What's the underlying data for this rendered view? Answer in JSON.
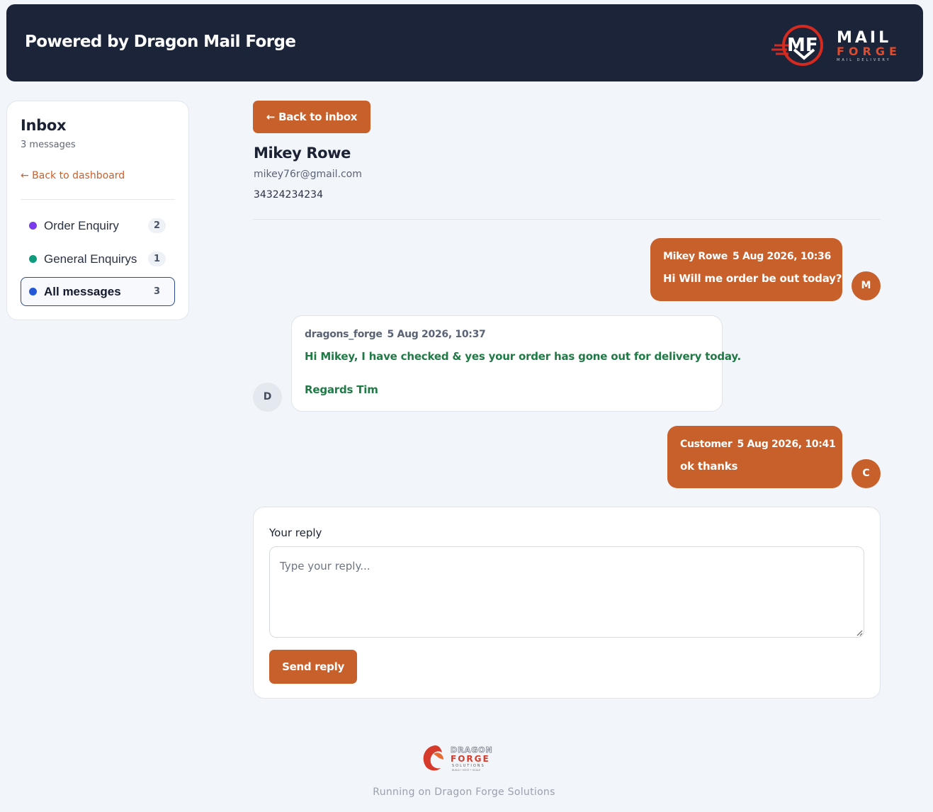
{
  "header": {
    "title": "Powered by Dragon Mail Forge",
    "logo": {
      "word1": "MAIL",
      "word2": "FORGE",
      "tagline": "MAIL DELIVERY",
      "monogram": "MF"
    }
  },
  "sidebar": {
    "title": "Inbox",
    "count_text": "3 messages",
    "back_link": "← Back to dashboard",
    "items": [
      {
        "label": "Order Enquiry",
        "count": "2",
        "dot_color": "#7c3aed",
        "active": false
      },
      {
        "label": "General Enquirys",
        "count": "1",
        "dot_color": "#0f9a7c",
        "active": false
      },
      {
        "label": "All messages",
        "count": "3",
        "dot_color": "#2557d6",
        "active": true
      }
    ]
  },
  "main": {
    "back_button": "← Back to inbox",
    "contact": {
      "name": "Mikey Rowe",
      "email": "mikey76r@gmail.com",
      "phone": "34324234234"
    }
  },
  "messages": [
    {
      "direction": "outgoing",
      "sender": "Mikey Rowe",
      "time": "5 Aug 2026, 10:36",
      "text": "Hi Will me order be out today?",
      "avatar": "M"
    },
    {
      "direction": "incoming",
      "sender": "dragons_forge",
      "time": "5 Aug 2026, 10:37",
      "lines": [
        "Hi Mikey, I have checked & yes your order has gone out for delivery today.",
        "Regards Tim"
      ],
      "avatar": "D"
    },
    {
      "direction": "outgoing",
      "sender": "Customer",
      "time": "5 Aug 2026, 10:41",
      "text": "ok thanks",
      "avatar": "C"
    }
  ],
  "reply": {
    "label": "Your reply",
    "placeholder": "Type your reply...",
    "value": "",
    "send_label": "Send reply"
  },
  "footer": {
    "text": "Running on Dragon Forge Solutions",
    "logo": {
      "word1": "DRAGON",
      "word2": "FORGE",
      "word3": "SOLUTIONS",
      "tagline": "BUILD • HOST • SCALE"
    }
  },
  "colors": {
    "header_bg": "#1c2439",
    "accent": "#c8602c",
    "incoming_text": "#1f7a45",
    "page_bg": "#f2f5fa"
  }
}
